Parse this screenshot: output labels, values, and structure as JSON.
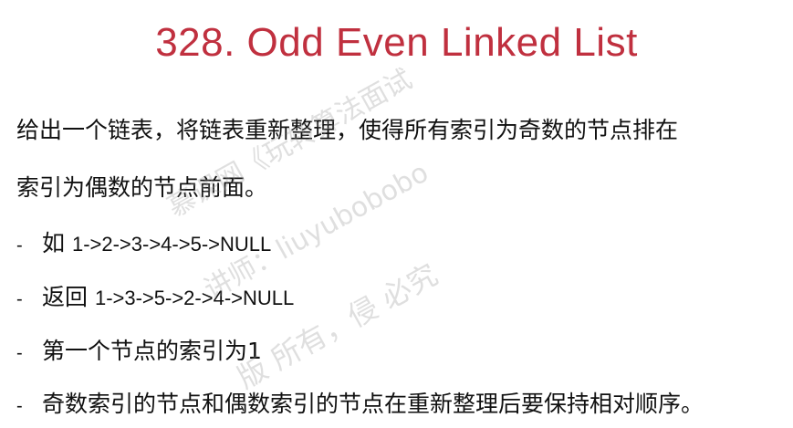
{
  "title": "328. Odd Even Linked List",
  "description": {
    "line1": "给出一个链表，将链表重新整理，使得所有索引为奇数的节点排在",
    "line2": "索引为偶数的节点前面。"
  },
  "bullets": [
    {
      "marker": "-",
      "prefix": "如 ",
      "code": "1->2->3->4->5->NULL"
    },
    {
      "marker": "-",
      "prefix": "返回 ",
      "code": "1->3->5->2->4->NULL"
    },
    {
      "marker": "-",
      "prefix": "第一个节点的索引为1",
      "code": ""
    },
    {
      "marker": "-",
      "prefix": "奇数索引的节点和偶数索引的节点在重新整理后要保持相对顺序。",
      "code": ""
    }
  ],
  "watermark": {
    "line1": "慕课网《玩转算法面试",
    "line2": "讲师：liuyubobobo",
    "line3": "版  所有，侵  必究"
  }
}
